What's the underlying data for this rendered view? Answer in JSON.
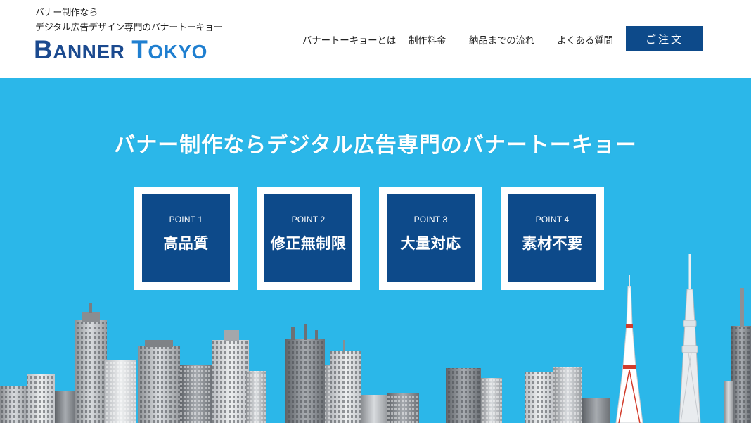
{
  "header": {
    "tagline_line1": "バナー制作なら",
    "tagline_line2": "デジタル広告デザイン専門のバナートーキョー",
    "logo": {
      "word1_initial": "B",
      "word1_rest": "ANNER",
      "word2_initial": "T",
      "word2_rest": "OKYO"
    },
    "nav": [
      {
        "label": "バナートーキョーとは"
      },
      {
        "label": "制作料金"
      },
      {
        "label": "納品までの流れ"
      },
      {
        "label": "よくある質問"
      }
    ],
    "order_button": "ご注文"
  },
  "hero": {
    "title": "バナー制作ならデジタル広告専門のバナートーキョー",
    "background_color": "#2bb7e9",
    "points": [
      {
        "point": "POINT 1",
        "label": "高品質"
      },
      {
        "point": "POINT 2",
        "label": "修正無制限"
      },
      {
        "point": "POINT 3",
        "label": "大量対応"
      },
      {
        "point": "POINT 4",
        "label": "素材不要"
      }
    ]
  },
  "colors": {
    "brand_navy": "#0d4a8a",
    "brand_blue": "#1f7fd0",
    "hero_blue": "#2bb7e9"
  }
}
